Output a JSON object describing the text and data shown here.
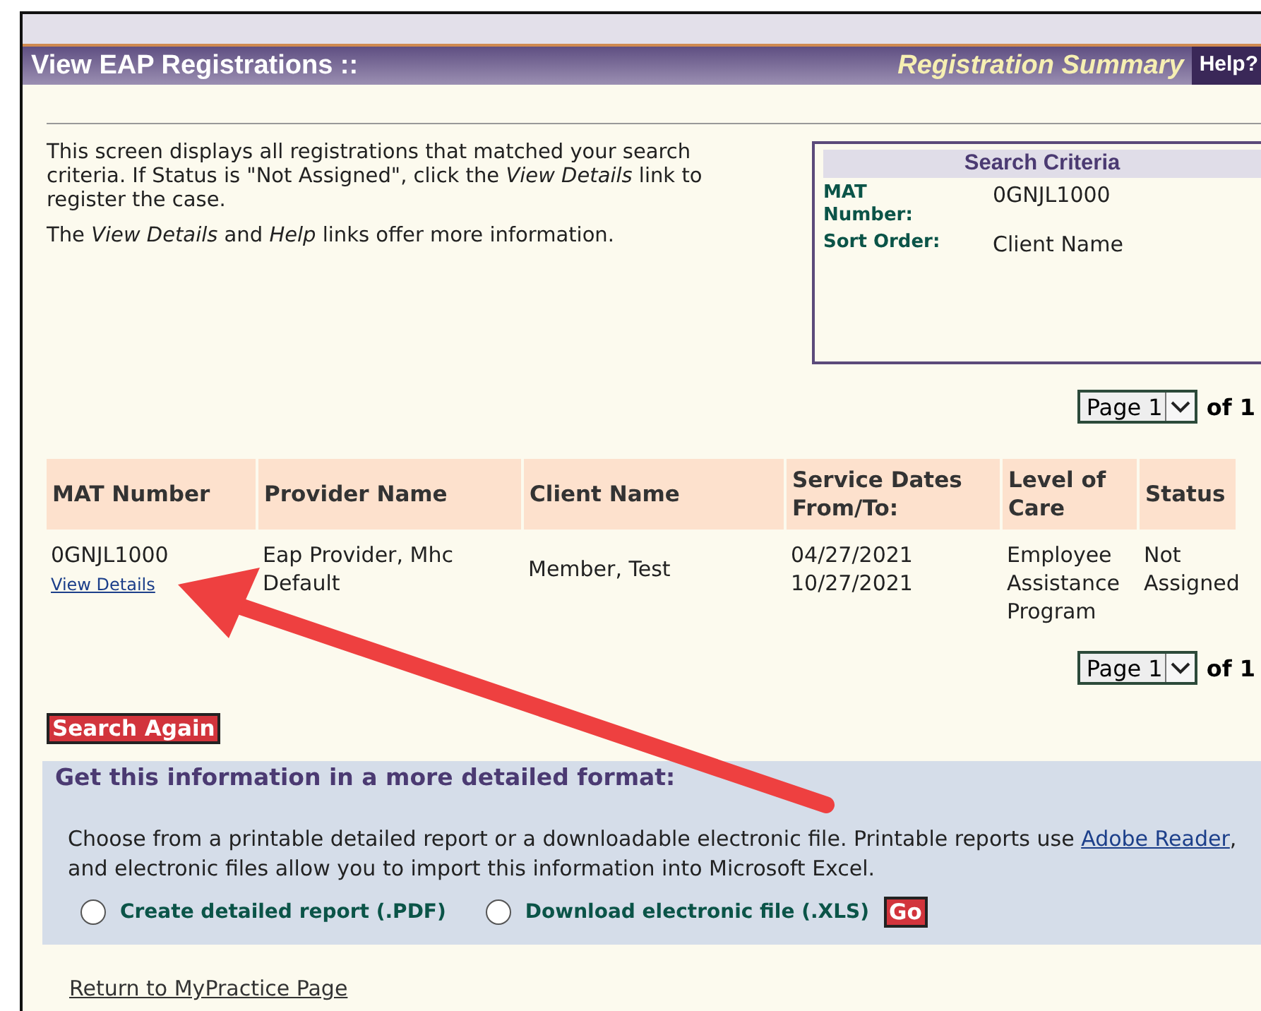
{
  "header": {
    "title": "View EAP Registrations ::",
    "subtitle": "Registration Summary",
    "help": "Help?"
  },
  "intro": [
    "This screen displays all registrations that matched your search criteria. If Status is \"Not Assigned\", click the *View Details* link to register the case.",
    "The *View Details* and *Help* links offer more information."
  ],
  "search_criteria": {
    "title": "Search Criteria",
    "fields": [
      {
        "label": "MAT Number:",
        "value": "0GNJL1000"
      },
      {
        "label": "Sort Order:",
        "value": "Client Name"
      }
    ]
  },
  "pager_top": {
    "value": "Page 1",
    "of": "of 1"
  },
  "table": {
    "columns": [
      "MAT Number",
      "Provider Name",
      "Client Name",
      "Service Dates From/To:",
      "Level of Care",
      "Status"
    ],
    "rows": [
      {
        "mat": "0GNJL1000",
        "link": "View Details",
        "provider": "Eap Provider, Mhc Default",
        "client": "Member, Test",
        "dates": [
          "04/27/2021",
          "10/27/2021"
        ],
        "care": "Employee Assistance Program",
        "status": "Not Assigned"
      }
    ]
  },
  "pager_bottom": {
    "value": "Page 1",
    "of": "of 1"
  },
  "search_again": "Search Again",
  "export": {
    "title": "Get this information in a more detailed format:",
    "text_before": "Choose from a printable detailed report or a downloadable electronic file. Printable reports use",
    "link": "Adobe Reader",
    "text_after": ", and electronic files allow you to import this information into Microsoft Excel.",
    "options": [
      {
        "label": "Create detailed report (.PDF)",
        "selected": false
      },
      {
        "label": "Download electronic file (.XLS)",
        "selected": false
      }
    ],
    "go": "Go"
  },
  "return_link": "Return to MyPractice Page"
}
